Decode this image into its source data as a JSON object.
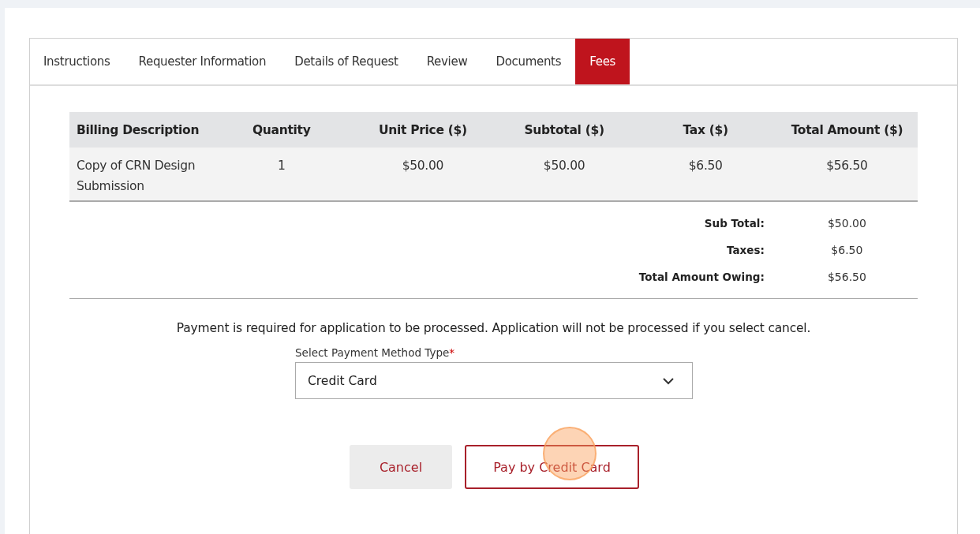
{
  "tabs": [
    {
      "label": "Instructions",
      "selected": false
    },
    {
      "label": "Requester Information",
      "selected": false
    },
    {
      "label": "Details of Request",
      "selected": false
    },
    {
      "label": "Review",
      "selected": false
    },
    {
      "label": "Documents",
      "selected": false
    },
    {
      "label": "Fees",
      "selected": true
    }
  ],
  "table": {
    "columns": [
      "Billing Description",
      "Quantity",
      "Unit Price ($)",
      "Subtotal ($)",
      "Tax ($)",
      "Total Amount ($)"
    ],
    "rows": [
      [
        "Copy of CRN Design Submission",
        "1",
        "$50.00",
        "$50.00",
        "$6.50",
        "$56.50"
      ]
    ]
  },
  "summary": [
    {
      "label": "Sub Total:",
      "value": "$50.00"
    },
    {
      "label": "Taxes:",
      "value": "$6.50"
    },
    {
      "label": "Total Amount Owing:",
      "value": "$56.50"
    }
  ],
  "notice": "Payment is required for application to be processed. Application will not be processed if you select cancel.",
  "payment_method": {
    "label": "Select Payment Method Type",
    "required_mark": "*",
    "value": "Credit Card"
  },
  "buttons": [
    {
      "label": "Cancel",
      "kind": "secondary"
    },
    {
      "label": "Pay by Credit Card",
      "kind": "primary"
    }
  ]
}
